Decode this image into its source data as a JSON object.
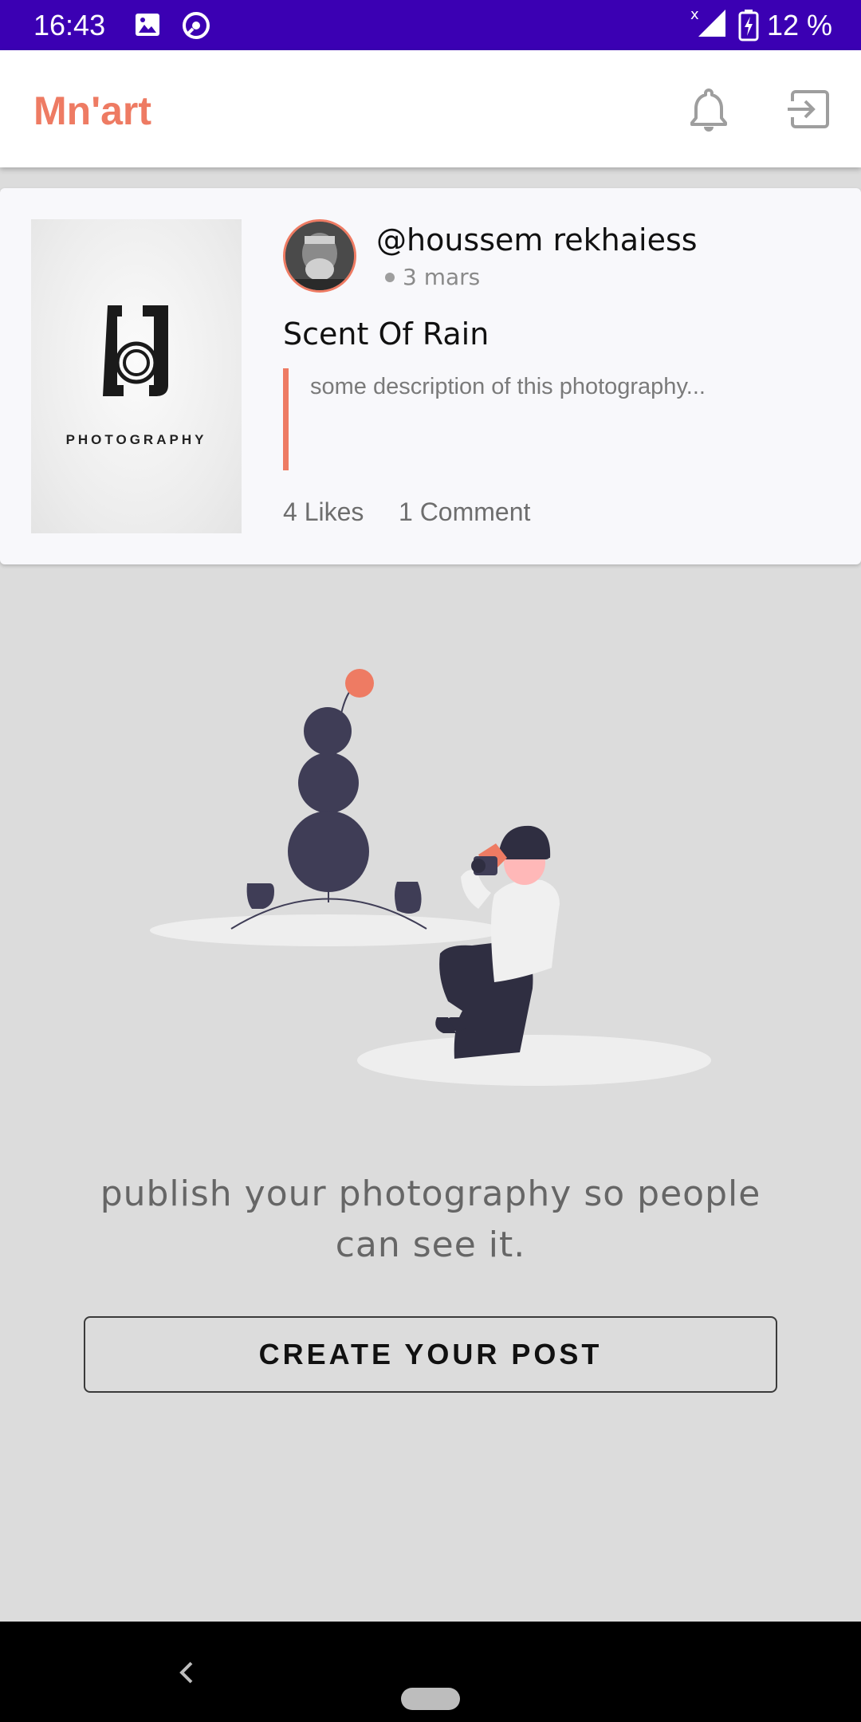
{
  "status_bar": {
    "time": "16:43",
    "battery": "12 %",
    "color": "#3b00b3"
  },
  "app_bar": {
    "title": "Mn'art",
    "title_color": "#ee7b63",
    "notifications_icon": "bell-icon",
    "logout_icon": "exit-icon"
  },
  "post": {
    "thumbnail_caption": "PHOTOGRAPHY",
    "username": "@houssem rekhaiess",
    "date": "3 mars",
    "title": "Scent Of Rain",
    "description": "some description of this photography...",
    "likes": "4 Likes",
    "comments": "1 Comment"
  },
  "empty_state": {
    "message": "publish your photography so people can see it.",
    "button_label": "CREATE YOUR POST"
  },
  "nav_bar": {
    "back_icon": "chevron-left-icon",
    "home_icon": "home-pill-icon"
  }
}
